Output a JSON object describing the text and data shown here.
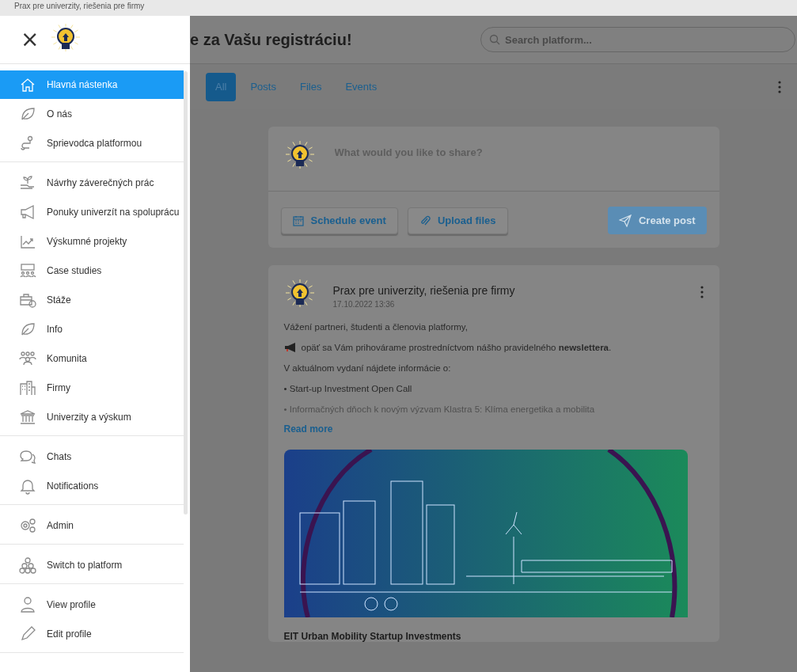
{
  "browser_tab_title": "Prax pre univerzity, riešenia pre firmy",
  "sidebar": {
    "close": "×",
    "groups": [
      [
        {
          "label": "Hlavná nástenka",
          "selected": true
        },
        {
          "label": "O nás",
          "selected": false
        },
        {
          "label": "Sprievodca platformou",
          "selected": false
        }
      ],
      [
        {
          "label": "Návrhy záverečných prác",
          "selected": false
        },
        {
          "label": "Ponuky univerzít na spoluprácu",
          "selected": false
        },
        {
          "label": "Výskumné projekty",
          "selected": false
        },
        {
          "label": "Case studies",
          "selected": false
        },
        {
          "label": "Stáže",
          "selected": false
        },
        {
          "label": "Info",
          "selected": false
        },
        {
          "label": "Komunita",
          "selected": false
        },
        {
          "label": "Firmy",
          "selected": false
        },
        {
          "label": "Univerzity a výskum",
          "selected": false
        }
      ],
      [
        {
          "label": "Chats",
          "selected": false
        },
        {
          "label": "Notifications",
          "selected": false
        }
      ],
      [
        {
          "label": "Admin",
          "selected": false
        }
      ],
      [
        {
          "label": "Switch to platform",
          "selected": false
        }
      ],
      [
        {
          "label": "View profile",
          "selected": false
        },
        {
          "label": "Edit profile",
          "selected": false
        }
      ]
    ]
  },
  "header": {
    "title": "e za Vašu registráciu!",
    "search": {
      "placeholder": "Search platform..."
    }
  },
  "tabs": [
    {
      "label": "All",
      "selected": true
    },
    {
      "label": "Posts",
      "selected": false
    },
    {
      "label": "Files",
      "selected": false
    },
    {
      "label": "Events",
      "selected": false
    }
  ],
  "composer": {
    "placeholder": "What would you like to share?",
    "buttons": [
      {
        "label": "Schedule event",
        "kind": "calendar"
      },
      {
        "label": "Upload files",
        "kind": "attach"
      }
    ],
    "submit": {
      "label": "Create post",
      "disabled": true
    }
  },
  "post": {
    "author": "Prax pre univerzity, riešenia pre firmy",
    "time": "17.10.2022 13:36",
    "lines": [
      {
        "text": "Vážení partneri, študenti a členovia platformy,",
        "faded": false
      },
      {
        "text": "opäť sa Vám prihovárame prostredníctvom nášho pravidelného **newslettera**.",
        "faded": false,
        "kind": "announce"
      },
      {
        "text": "V aktuálnom vydaní nájdete informácie o:",
        "faded": false
      },
      {
        "text": "• Start-up Investment Open Call",
        "faded": false
      },
      {
        "text": "• Informačných dňoch k novým výzvam Klastra 5: Klíma energetika a mobilita",
        "faded": true
      }
    ],
    "read_more": "Read more",
    "image_caption": "EIT Urban Mobility Startup Investments"
  }
}
